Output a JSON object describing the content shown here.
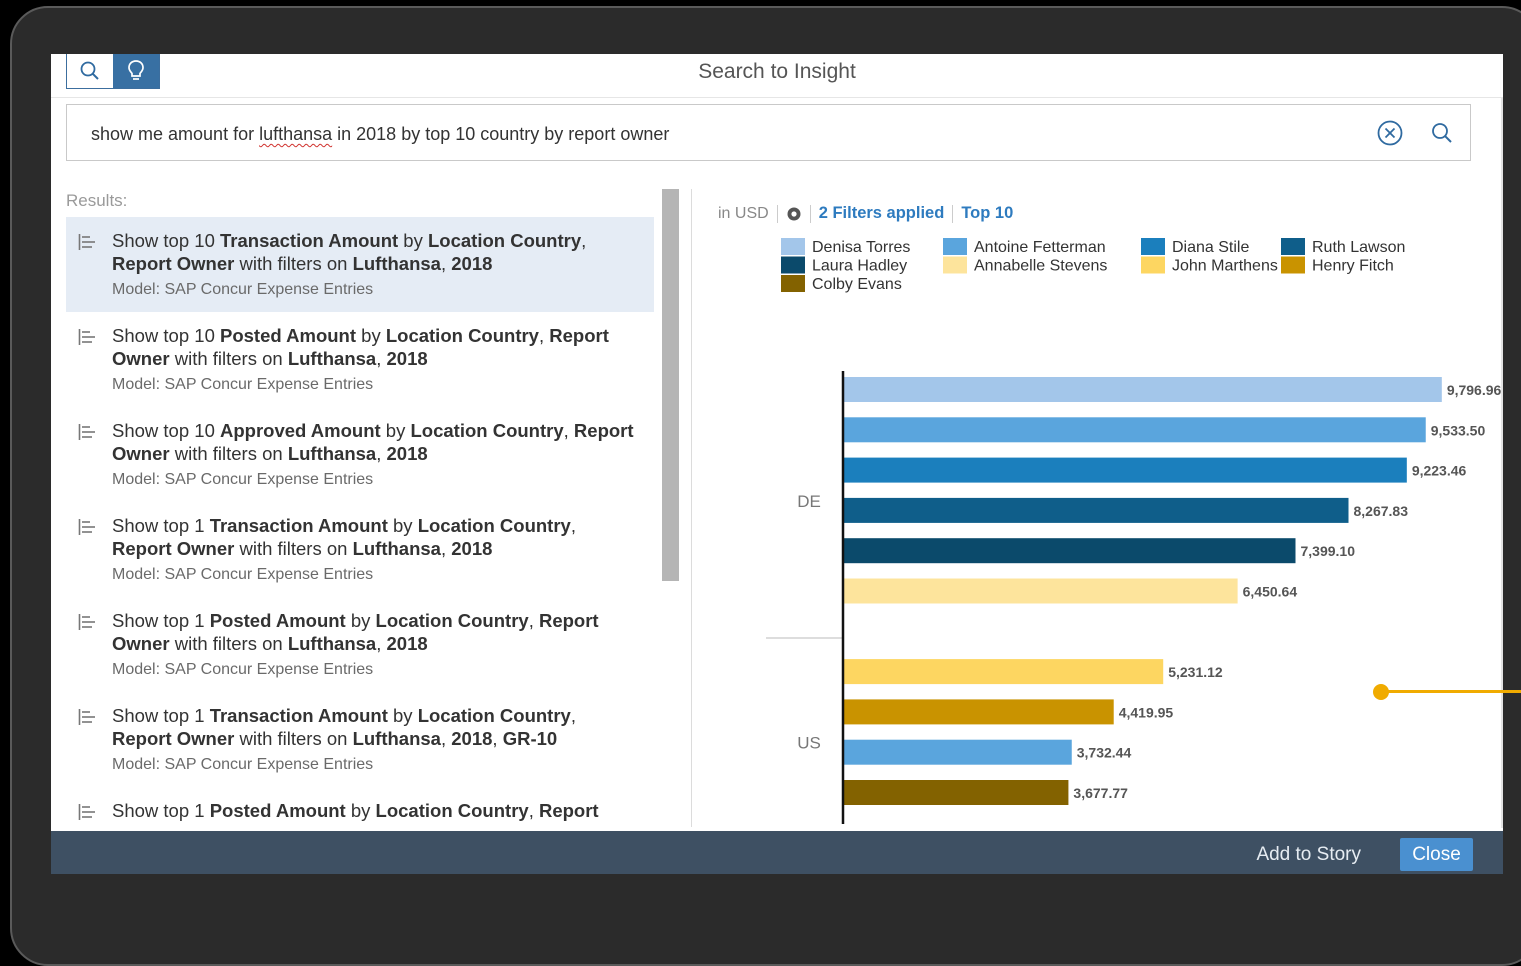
{
  "header": {
    "title": "Search to Insight",
    "search_query_pre": "show me amount for ",
    "search_query_misspelled": "lufthansa",
    "search_query_post": " in 2018 by top 10 country by report owner"
  },
  "results": {
    "label": "Results:",
    "items": [
      {
        "parts": [
          "Show top 10 ",
          "Transaction Amount",
          " by ",
          "Location Country",
          ", ",
          "Report Owner",
          " with filters on ",
          "Lufthansa",
          ", ",
          "2018"
        ],
        "model": "Model: SAP Concur Expense Entries"
      },
      {
        "parts": [
          "Show top 10 ",
          "Posted Amount",
          " by ",
          "Location Country",
          ", ",
          "Report Owner",
          " with filters on ",
          "Lufthansa",
          ", ",
          "2018"
        ],
        "model": "Model: SAP Concur Expense Entries"
      },
      {
        "parts": [
          "Show top 10 ",
          "Approved Amount",
          " by ",
          "Location Country",
          ", ",
          "Report Owner",
          " with filters on ",
          "Lufthansa",
          ", ",
          "2018"
        ],
        "model": "Model: SAP Concur Expense Entries"
      },
      {
        "parts": [
          "Show top 1 ",
          "Transaction Amount",
          " by ",
          "Location Country",
          ", ",
          "Report Owner",
          " with filters on ",
          "Lufthansa",
          ", ",
          "2018"
        ],
        "model": "Model: SAP Concur Expense Entries"
      },
      {
        "parts": [
          "Show top 1 ",
          "Posted Amount",
          " by ",
          "Location Country",
          ", ",
          "Report Owner",
          " with filters on ",
          "Lufthansa",
          ", ",
          "2018"
        ],
        "model": "Model: SAP Concur Expense Entries"
      },
      {
        "parts": [
          "Show top 1 ",
          "Transaction Amount",
          " by ",
          "Location Country",
          ", ",
          "Report Owner",
          " with filters on ",
          "Lufthansa",
          ", ",
          "2018",
          ", ",
          "GR-10"
        ],
        "model": "Model: SAP Concur Expense Entries"
      },
      {
        "parts": [
          "Show top 1 ",
          "Posted Amount",
          " by ",
          "Location Country",
          ", ",
          "Report"
        ],
        "model": ""
      }
    ]
  },
  "chart_header": {
    "unit": "in USD",
    "filters": "2 Filters applied",
    "top": "Top 10"
  },
  "chart_data": {
    "type": "bar",
    "orientation": "horizontal",
    "groups": [
      {
        "name": "DE",
        "bars": [
          {
            "series": "Denisa Torres",
            "value": 9796.96,
            "label": "9,796.96"
          },
          {
            "series": "Antoine Fetterman",
            "value": 9533.5,
            "label": "9,533.50"
          },
          {
            "series": "Diana Stile",
            "value": 9223.46,
            "label": "9,223.46"
          },
          {
            "series": "Ruth Lawson",
            "value": 8267.83,
            "label": "8,267.83"
          },
          {
            "series": "Laura Hadley",
            "value": 7399.1,
            "label": "7,399.10"
          },
          {
            "series": "Annabelle Stevens",
            "value": 6450.64,
            "label": "6,450.64"
          }
        ]
      },
      {
        "name": "US",
        "bars": [
          {
            "series": "John Marthens",
            "value": 5231.12,
            "label": "5,231.12"
          },
          {
            "series": "Henry Fitch",
            "value": 4419.95,
            "label": "4,419.95"
          },
          {
            "series": "Antoine Fetterman",
            "value": 3732.44,
            "label": "3,732.44"
          },
          {
            "series": "Colby Evans",
            "value": 3677.77,
            "label": "3,677.77"
          }
        ]
      }
    ],
    "legend": [
      {
        "name": "Denisa Torres",
        "color": "#a3c6ea"
      },
      {
        "name": "Antoine Fetterman",
        "color": "#5aa5dd"
      },
      {
        "name": "Diana Stile",
        "color": "#1b7fbd"
      },
      {
        "name": "Ruth Lawson",
        "color": "#0f5e8a"
      },
      {
        "name": "Laura Hadley",
        "color": "#0b4a6b"
      },
      {
        "name": "Annabelle Stevens",
        "color": "#fde49c"
      },
      {
        "name": "John Marthens",
        "color": "#fdd661"
      },
      {
        "name": "Henry Fitch",
        "color": "#c99300"
      },
      {
        "name": "Colby Evans",
        "color": "#836200"
      }
    ],
    "legend_position": "top",
    "xlim": [
      0,
      9800
    ],
    "grid": false
  },
  "footer": {
    "add_to_story": "Add to Story",
    "close": "Close"
  }
}
